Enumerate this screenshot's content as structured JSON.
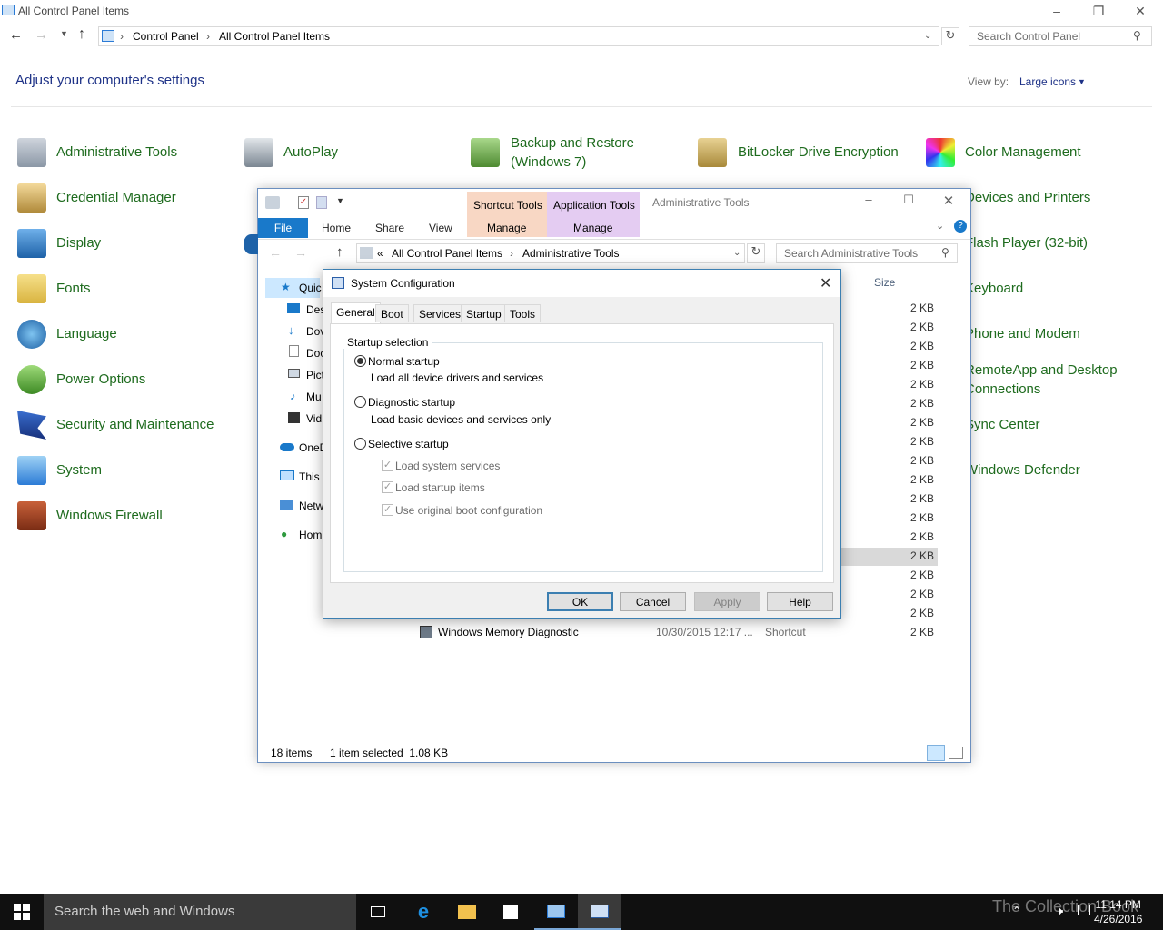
{
  "control_panel": {
    "title": "All Control Panel Items",
    "breadcrumb": [
      "Control Panel",
      "All Control Panel Items"
    ],
    "search_placeholder": "Search Control Panel",
    "heading": "Adjust your computer's settings",
    "view_by_label": "View by:",
    "view_by_value": "Large icons",
    "items_col1": [
      "Administrative Tools",
      "Credential Manager",
      "Display",
      "Fonts",
      "Language",
      "Power Options",
      "Security and Maintenance",
      "System",
      "Windows Firewall"
    ],
    "items_col2": [
      "AutoPlay"
    ],
    "items_col3": [
      "Backup and Restore",
      "(Windows 7)"
    ],
    "items_col4": [
      "BitLocker Drive Encryption"
    ],
    "items_col5": [
      "Color Management",
      "Devices and Printers",
      "Flash Player (32-bit)",
      "Keyboard",
      "Phone and Modem",
      "RemoteApp and Desktop",
      "Connections",
      "Sync Center",
      "Windows Defender"
    ]
  },
  "explorer": {
    "title": "Administrative Tools",
    "context_tabs": [
      "Shortcut Tools",
      "Application Tools"
    ],
    "manage_label": "Manage",
    "ribbon_tabs": [
      "File",
      "Home",
      "Share",
      "View"
    ],
    "breadcrumb": [
      "All Control Panel Items",
      "Administrative Tools"
    ],
    "breadcrumb_prefix": "«",
    "search_placeholder": "Search Administrative Tools",
    "nav": [
      "Quic",
      "Des",
      "Dov",
      "Doc",
      "Pict",
      "Mu",
      "Vid",
      "OneD",
      "This",
      "Netw",
      "Hom"
    ],
    "size_header": "Size",
    "sizes": [
      "2 KB",
      "2 KB",
      "2 KB",
      "2 KB",
      "2 KB",
      "2 KB",
      "2 KB",
      "2 KB",
      "2 KB",
      "2 KB",
      "2 KB",
      "2 KB",
      "2 KB",
      "2 KB",
      "2 KB",
      "2 KB",
      "2 KB",
      "2 KB"
    ],
    "last_row": {
      "name": "Windows Memory Diagnostic",
      "date": "10/30/2015 12:17 ...",
      "type": "Shortcut",
      "size": "2 KB"
    },
    "status_items": "18 items",
    "status_selected": "1 item selected  1.08 KB"
  },
  "dialog": {
    "title": "System Configuration",
    "tabs": [
      "General",
      "Boot",
      "Services",
      "Startup",
      "Tools"
    ],
    "group_label": "Startup selection",
    "normal": "Normal startup",
    "normal_desc": "Load all device drivers and services",
    "diagnostic": "Diagnostic startup",
    "diagnostic_desc": "Load basic devices and services only",
    "selective": "Selective startup",
    "chk1": "Load system services",
    "chk2": "Load startup items",
    "chk3": "Use original boot configuration",
    "buttons": {
      "ok": "OK",
      "cancel": "Cancel",
      "apply": "Apply",
      "help": "Help"
    }
  },
  "taskbar": {
    "search": "Search the web and Windows",
    "time": "11:14 PM",
    "date": "4/26/2016",
    "watermark": "The Collection Book"
  }
}
